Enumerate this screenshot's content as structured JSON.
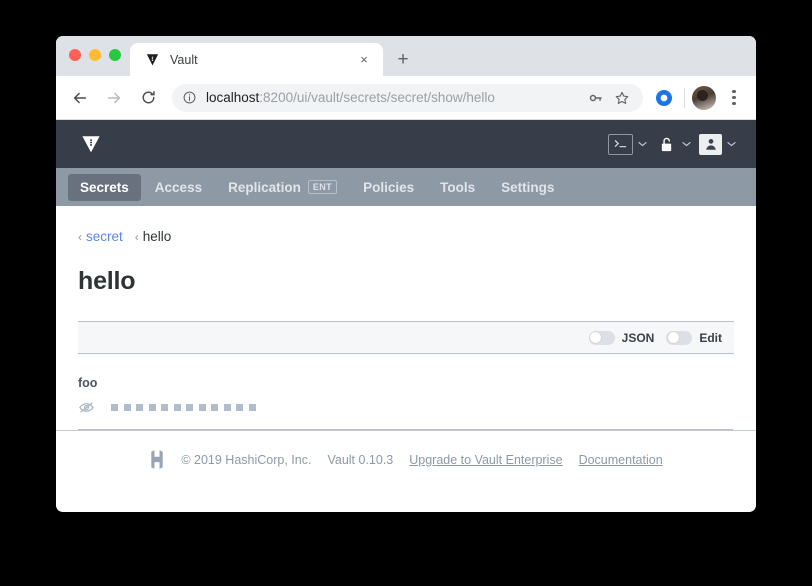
{
  "browser": {
    "tab": {
      "title": "Vault",
      "favicon": "vault-logo-icon",
      "close": "×"
    },
    "new_tab": "+",
    "nav": {
      "back": "←",
      "forward": "→",
      "reload": "⟳"
    },
    "omnibox": {
      "info_icon": "info-circle-icon",
      "url_host": "localhost",
      "url_rest": ":8200/ui/vault/secrets/secret/show/hello",
      "full_url": "localhost:8200/ui/vault/secrets/secret/show/hello",
      "key_icon": "key-icon",
      "bookmark_icon": "star-icon"
    },
    "extension_icon": "browser-extension-icon",
    "avatar": "profile-avatar",
    "menu_icon": "three-dot-menu-icon"
  },
  "vault": {
    "logo": "vault-logo-icon",
    "header_actions": [
      {
        "name": "console",
        "icon": ">_",
        "chevron": "⌄"
      },
      {
        "name": "seal-status",
        "icon": "unlocked-padlock-icon",
        "chevron": "⌄"
      },
      {
        "name": "user-menu",
        "icon": "user-icon",
        "chevron": "⌄"
      }
    ],
    "nav_tabs": [
      {
        "label": "Secrets",
        "active": true,
        "badge": ""
      },
      {
        "label": "Access",
        "active": false,
        "badge": ""
      },
      {
        "label": "Replication",
        "active": false,
        "badge": "ENT"
      },
      {
        "label": "Policies",
        "active": false,
        "badge": ""
      },
      {
        "label": "Tools",
        "active": false,
        "badge": ""
      },
      {
        "label": "Settings",
        "active": false,
        "badge": ""
      }
    ],
    "breadcrumb": [
      {
        "arrow": "‹",
        "label": "secret",
        "is_link": true
      },
      {
        "arrow": "‹",
        "label": "hello",
        "is_link": false
      }
    ],
    "page_title": "hello",
    "toolbar": {
      "json_toggle_label": "JSON",
      "json_toggle_on": false,
      "edit_toggle_label": "Edit",
      "edit_toggle_on": false
    },
    "secret": {
      "key": "foo",
      "value_masked": true,
      "mask_char_count": 12,
      "reveal_icon": "eye-off-icon"
    },
    "footer": {
      "logo": "hashicorp-logo-icon",
      "copyright": "© 2019 HashiCorp, Inc.",
      "version": "Vault 0.10.3",
      "upgrade_link": "Upgrade to Vault Enterprise",
      "docs_link": "Documentation"
    }
  },
  "colors": {
    "vault_header_bg": "#373d49",
    "vault_nav_bg": "#8e99a6",
    "vault_nav_active_bg": "#68717d",
    "link_blue": "#5d87ef",
    "muted": "#8e99a6",
    "border": "#b7c0cc"
  }
}
